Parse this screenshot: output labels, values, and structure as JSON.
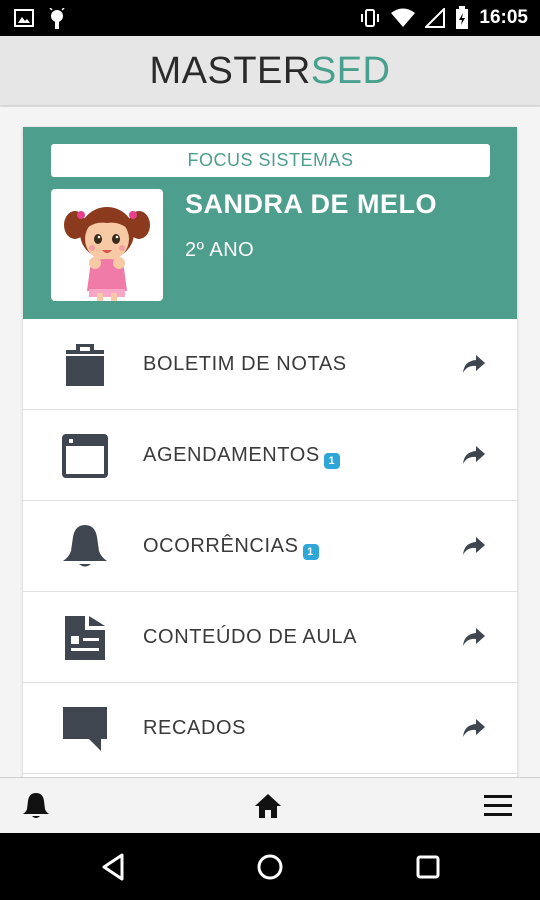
{
  "status_bar": {
    "time": "16:05",
    "left_icons": [
      "image-icon",
      "android-icon"
    ],
    "right_icons": [
      "vibrate-icon",
      "wifi-icon",
      "signal-icon",
      "battery-icon"
    ]
  },
  "header": {
    "title_part1": "MASTER",
    "title_part2": "SED",
    "accent_color": "#4aa08e"
  },
  "profile": {
    "school": "FOCUS SISTEMAS",
    "student_name": "SANDRA DE MELO",
    "grade": "2º ANO",
    "avatar_icon": "girl-avatar-icon",
    "background_color": "#4e9e8e"
  },
  "menu": {
    "items": [
      {
        "label": "BOLETIM DE NOTAS",
        "icon": "clipboard-icon",
        "badge": ""
      },
      {
        "label": "AGENDAMENTOS",
        "icon": "calendar-window-icon",
        "badge": "1"
      },
      {
        "label": "OCORRÊNCIAS",
        "icon": "bell-icon",
        "badge": "1"
      },
      {
        "label": "CONTEÚDO DE AULA",
        "icon": "document-icon",
        "badge": ""
      },
      {
        "label": "RECADOS",
        "icon": "message-icon",
        "badge": ""
      }
    ],
    "arrow_icon": "share-arrow-icon",
    "badge_color": "#2fa6d8"
  },
  "bottom_nav": {
    "items": [
      "bell-icon",
      "home-icon",
      "menu-icon"
    ]
  },
  "system_nav": {
    "items": [
      "back-icon",
      "home-circle-icon",
      "recents-icon"
    ]
  }
}
